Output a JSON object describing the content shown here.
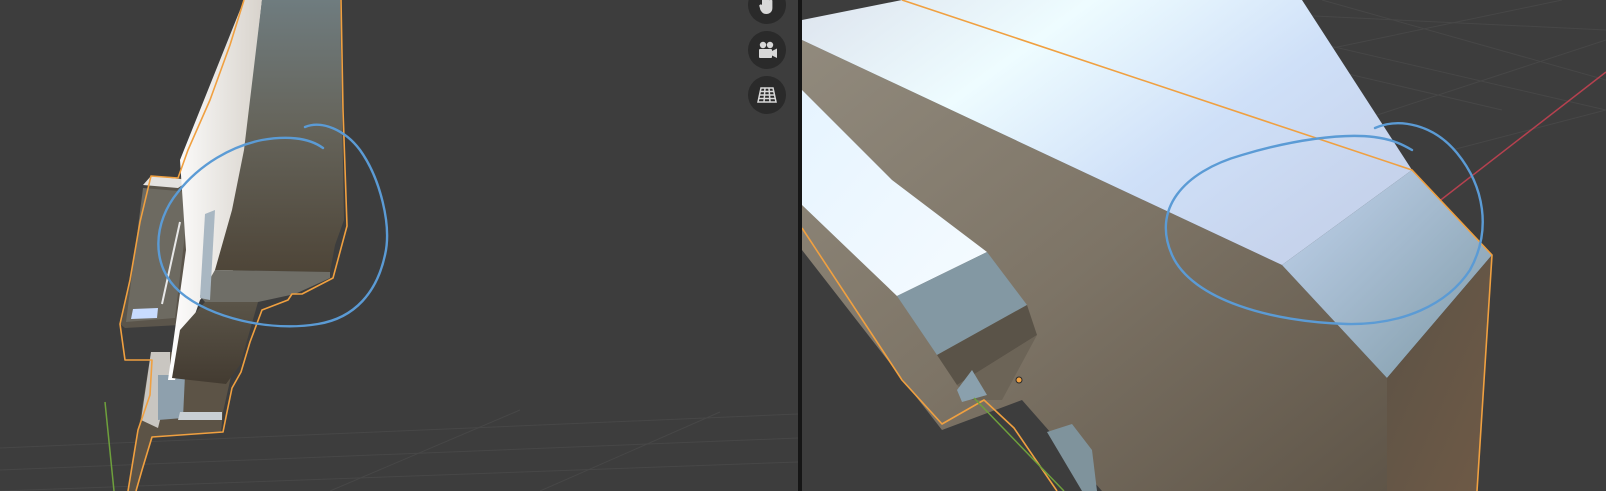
{
  "app": {
    "name": "3D Viewport"
  },
  "colors": {
    "viewport_background": "#3d3d3d",
    "grid_line": "#4a4a4a",
    "selection_outline": "#f0a040",
    "annotation_stroke": "#5b9bd5",
    "axis_x": "#b5414f",
    "axis_y": "#6ea03c",
    "nav_button_bg": "#2a2a2a",
    "nav_icon": "#d8d8d8"
  },
  "left_viewport": {
    "nav_buttons": [
      {
        "name": "hand-pan-icon",
        "action": "pan-view"
      },
      {
        "name": "camera-icon",
        "action": "toggle-camera-view"
      },
      {
        "name": "grid-perspective-icon",
        "action": "toggle-orthographic"
      }
    ]
  },
  "right_viewport": {}
}
